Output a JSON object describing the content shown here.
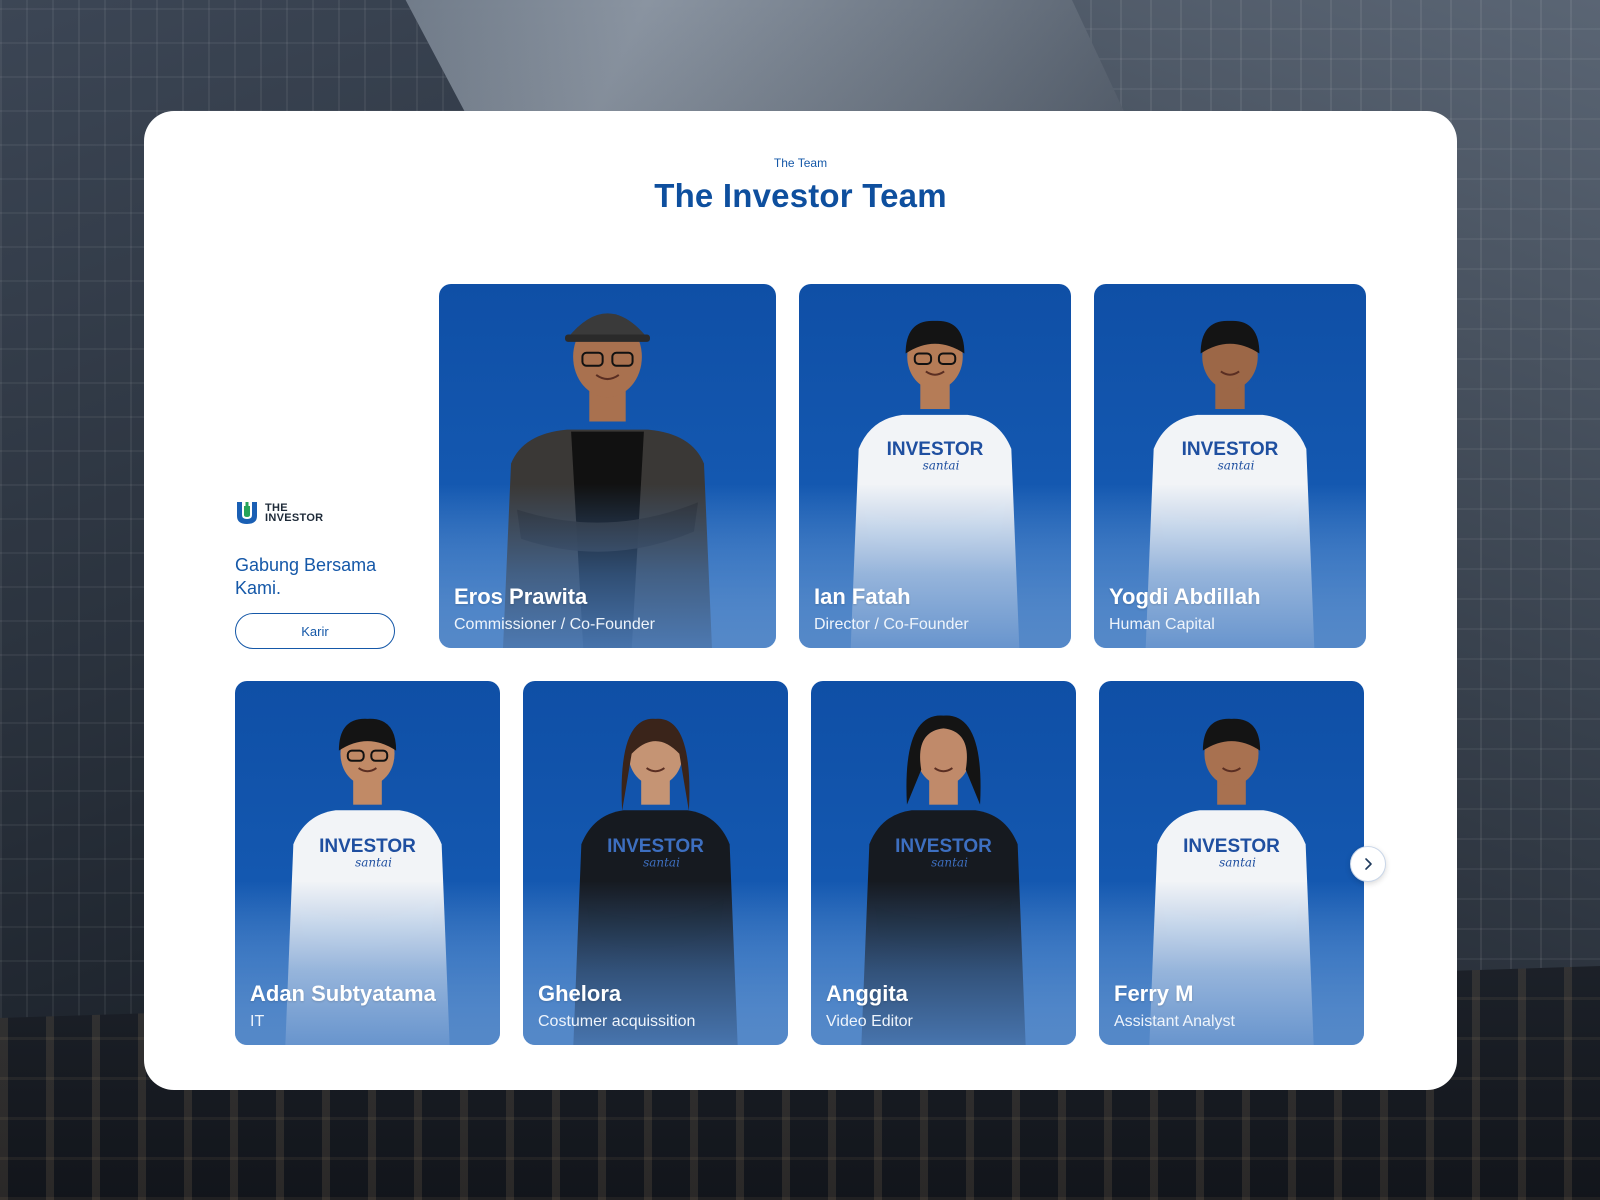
{
  "header": {
    "eyebrow": "The Team",
    "title": "The Investor Team"
  },
  "brand": {
    "line1": "THE",
    "line2": "INVESTOR",
    "colors": {
      "green": "#27a35a",
      "blue": "#1a5fb4"
    }
  },
  "join": {
    "text": "Gabung Bersama Kami.",
    "button_label": "Karir"
  },
  "team": [
    {
      "name": "Eros Prawita",
      "role": "Commissioner / Co-Founder",
      "shirt": "black"
    },
    {
      "name": "Ian Fatah",
      "role": "Director / Co-Founder",
      "shirt": "white"
    },
    {
      "name": "Yogdi Abdillah",
      "role": "Human Capital",
      "shirt": "white"
    },
    {
      "name": "Adan Subtyatama",
      "role": "IT",
      "shirt": "white"
    },
    {
      "name": "Ghelora",
      "role": "Costumer acquissition",
      "shirt": "black"
    },
    {
      "name": "Anggita",
      "role": "Video Editor",
      "shirt": "black"
    },
    {
      "name": "Ferry M",
      "role": "Assistant Analyst",
      "shirt": "white"
    }
  ],
  "shirt_print": {
    "main": "INVESTOR",
    "script": "santai"
  },
  "carousel": {
    "next_icon": "chevron-right-icon"
  },
  "colors": {
    "primary": "#0e4f9e",
    "card_top": "#0f4fa6",
    "card_bottom": "#6c9ed5"
  }
}
